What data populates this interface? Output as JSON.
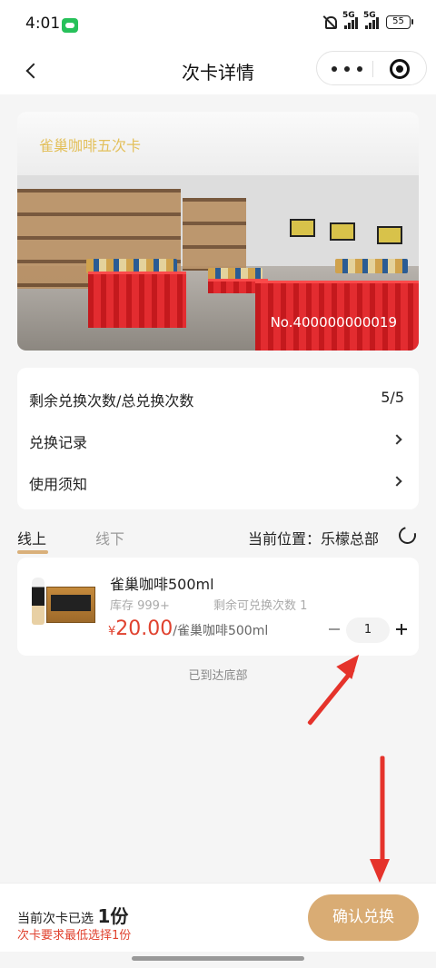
{
  "status_bar": {
    "time": "4:01",
    "network_1": "5G",
    "network_2": "5G",
    "battery": "55"
  },
  "nav": {
    "title": "次卡详情"
  },
  "hero": {
    "card_name": "雀巢咖啡五次卡",
    "card_number": "No.400000000019"
  },
  "info": {
    "remaining_label": "剩余兑换次数/总兑换次数",
    "remaining_value": "5/5",
    "history_label": "兑换记录",
    "notice_label": "使用须知"
  },
  "tabs": {
    "online": "线上",
    "offline": "线下",
    "location": "当前位置：乐檬总部"
  },
  "product": {
    "name": "雀巢咖啡500ml",
    "stock": "库存 999+",
    "remaining": "剩余可兑换次数 1",
    "currency": "¥",
    "price": "20.00",
    "unit": "/雀巢咖啡500ml",
    "quantity": "1"
  },
  "end_note": "已到达底部",
  "bottom": {
    "selected_prefix": "当前次卡已选",
    "selected_count": "1份",
    "min_note": "次卡要求最低选择1份",
    "confirm_label": "确认兑换"
  },
  "colors": {
    "accent": "#d9ac74",
    "price": "#e0422f",
    "annotation_arrow": "#e5332b"
  }
}
